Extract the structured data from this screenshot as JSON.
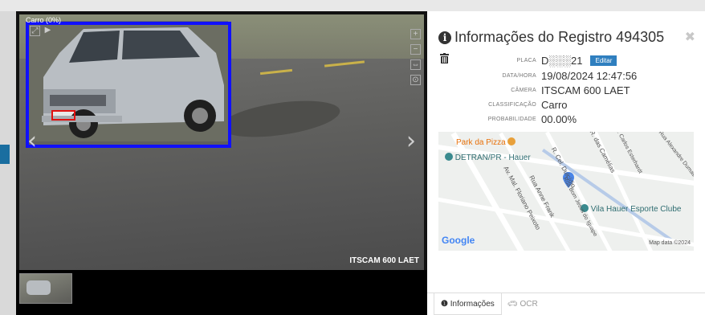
{
  "viewer": {
    "camera_overlay": "Carro (0%)",
    "footer_label": "ITSCAM 600 LAET",
    "prev_arrow": "‹",
    "next_arrow": "›",
    "controls": [
      "+",
      "−",
      "⇔",
      "⊙"
    ]
  },
  "panel": {
    "title": "Informações do Registro 494305",
    "close_icon": "✖",
    "fields": {
      "placa_label": "PLACA",
      "placa_value": "D░░░21",
      "edit_label": "Editar",
      "datahora_label": "DATA/HORA",
      "datahora_value": "19/08/2024 12:47:56",
      "camera_label": "CÂMERA",
      "camera_value": "ITSCAM 600 LAET",
      "classificacao_label": "CLASSIFICAÇÃO",
      "classificacao_value": "Carro",
      "probabilidade_label": "PROBABILIDADE",
      "probabilidade_value": "00.00%"
    },
    "map": {
      "poi_pizza": "Park da Pizza",
      "poi_detran": "DETRAN/PR - Hauer",
      "poi_vila": "Vila Hauer Esporte Clube",
      "street_camelias": "R. das Camélias",
      "street_floriano": "Av. Mal. Floriano Peixoto",
      "street_anne": "Rua Anne Frank",
      "street_cel": "R. Cel. Dulcídio",
      "street_bom_jesus": "Rua Bom Jesus do Iguape",
      "street_carlos": "R. Carlos Esterhardt",
      "street_alexandre": "Rua Alexandre Dumas",
      "google": "Google",
      "map_data": "Map data ©2024"
    },
    "tabs": {
      "info": "Informações",
      "ocr": "OCR"
    }
  },
  "colors": {
    "bbox": "#1010ff",
    "plate_box": "#e01010",
    "edit_button": "#2f7fbf"
  }
}
